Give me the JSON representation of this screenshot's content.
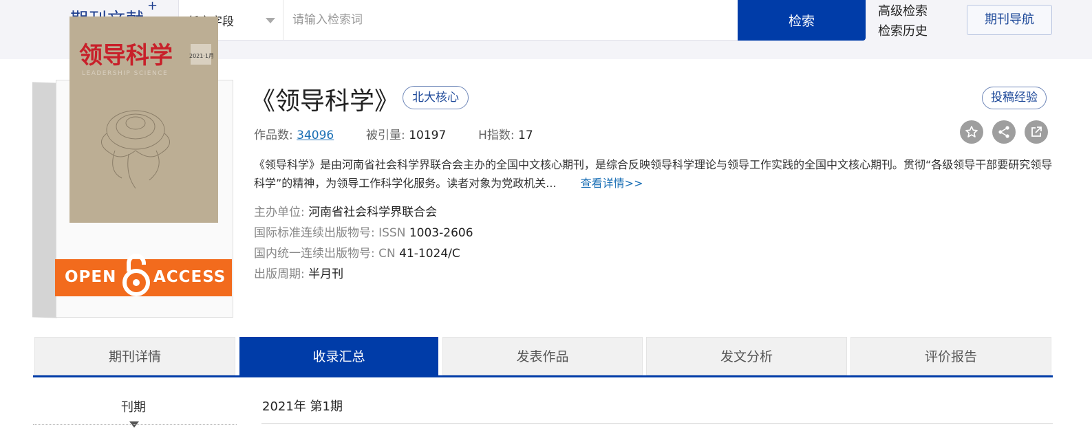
{
  "header": {
    "logo": "期刊文献",
    "logo_plus": "+",
    "field_select": "任意字段",
    "search_placeholder": "请输入检索词",
    "search_button": "检索",
    "advanced_search": "高级检索",
    "search_history": "检索历史",
    "journal_nav": "期刊导航"
  },
  "cover": {
    "title": "领导科学",
    "subtitle": "LEADERSHIP SCIENCE",
    "issue_tag": "2021·1月",
    "oa_left": "OPEN",
    "oa_right": "ACCESS"
  },
  "journal": {
    "title": "《领导科学》",
    "badge": "北大核心",
    "submit_experience": "投稿经验",
    "works_label": "作品数:",
    "works_value": "34096",
    "cited_label": "被引量:",
    "cited_value": "10197",
    "h_label": "H指数:",
    "h_value": "17",
    "description": "《领导科学》是由河南省社会科学界联合会主办的全国中文核心期刊，是综合反映领导科学理论与领导工作实践的全国中文核心期刊。贯彻“各级领导干部要研究领导科学”的精神，为领导工作科学化服务。读者对象为党政机关...",
    "more_link": "查看详情>>",
    "sponsor_label": "主办单位:",
    "sponsor_value": "河南省社会科学界联合会",
    "issn_label": "国际标准连续出版物号: ISSN",
    "issn_value": "1003-2606",
    "cn_label": "国内统一连续出版物号: CN",
    "cn_value": "41-1024/C",
    "cycle_label": "出版周期:",
    "cycle_value": "半月刊"
  },
  "actions": {
    "icons": [
      "star-icon",
      "share-icon",
      "external-link-icon"
    ],
    "icon_color": "#9e9e9e"
  },
  "tabs": [
    {
      "label": "期刊详情",
      "active": false
    },
    {
      "label": "收录汇总",
      "active": true
    },
    {
      "label": "发表作品",
      "active": false
    },
    {
      "label": "发文分析",
      "active": false
    },
    {
      "label": "评价报告",
      "active": false
    }
  ],
  "issue": {
    "label": "刊期",
    "value": "2021年 第1期"
  },
  "colors": {
    "brand": "#003ca8",
    "link": "#1a6fb5",
    "oa_orange": "#f26b1d"
  }
}
